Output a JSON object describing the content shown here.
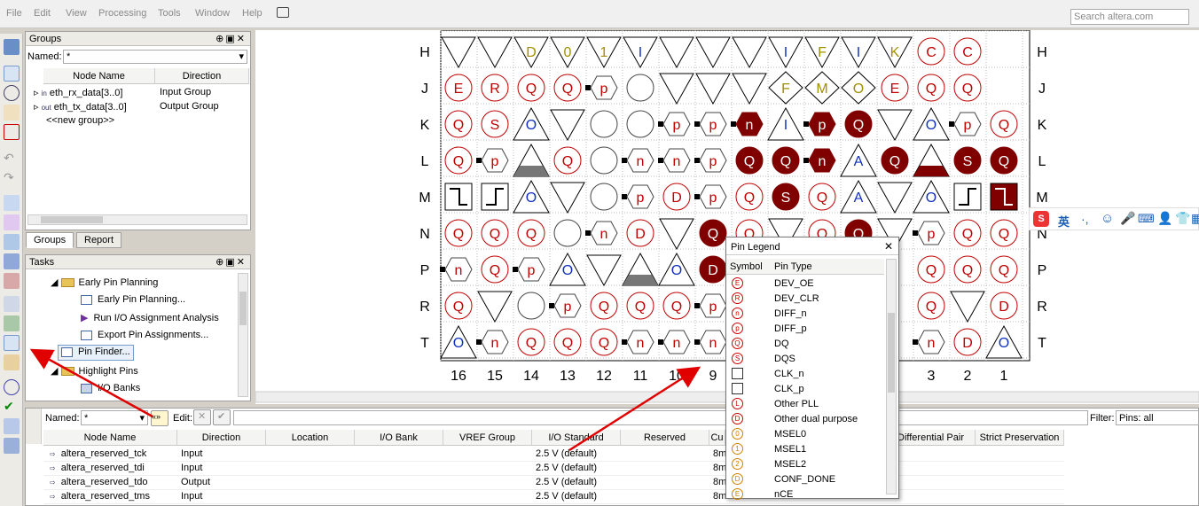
{
  "menu": [
    "File",
    "Edit",
    "View",
    "Processing",
    "Tools",
    "Window",
    "Help"
  ],
  "search_placeholder": "Search altera.com",
  "groups_panel": {
    "title": "Groups",
    "named_label": "Named:",
    "named_value": "*",
    "col_node": "Node Name",
    "col_direction": "Direction",
    "rows": [
      {
        "name": "eth_rx_data[3..0]",
        "direction": "Input Group"
      },
      {
        "name": "eth_tx_data[3..0]",
        "direction": "Output Group"
      },
      {
        "name": "<<new group>>",
        "direction": ""
      }
    ],
    "tab_groups": "Groups",
    "tab_report": "Report"
  },
  "tasks_panel": {
    "title": "Tasks",
    "items": [
      {
        "label": "Early Pin Planning",
        "kind": "folder",
        "indent": 0
      },
      {
        "label": "Early Pin Planning...",
        "kind": "doc",
        "indent": 1
      },
      {
        "label": "Run I/O Assignment Analysis",
        "kind": "run",
        "indent": 1
      },
      {
        "label": "Export Pin Assignments...",
        "kind": "doc",
        "indent": 1
      },
      {
        "label": "Pin Finder...",
        "kind": "doc",
        "indent": 0,
        "selected": true
      },
      {
        "label": "Highlight Pins",
        "kind": "folder",
        "indent": 0
      },
      {
        "label": "I/O Banks",
        "kind": "grid",
        "indent": 1
      }
    ]
  },
  "pin_grid": {
    "rows": [
      "H",
      "J",
      "K",
      "L",
      "M",
      "N",
      "P",
      "R",
      "T"
    ],
    "cols": [
      "16",
      "15",
      "14",
      "13",
      "12",
      "11",
      "10",
      "9",
      "",
      "",
      "",
      "",
      "",
      "3",
      "2",
      "1"
    ],
    "cells": [
      [
        "tv",
        "tv",
        "D",
        "0",
        "1",
        "I",
        "tv",
        "tv",
        "tv",
        "I",
        "F",
        "I",
        "K",
        "C",
        "C"
      ],
      [
        "E",
        "R",
        "Q",
        "Q",
        "p",
        "o",
        "tv",
        "tv",
        "tv",
        "F",
        "M",
        "O",
        "E",
        "Q",
        "Q"
      ],
      [
        "Q",
        "S",
        "Ot",
        "tv",
        "o",
        "o",
        "p",
        "p",
        "nF",
        "It",
        "pF",
        "QF",
        "tv",
        "Ot",
        "p",
        "Q"
      ],
      [
        "Q",
        "p",
        "tF",
        "Q",
        "o",
        "n",
        "n",
        "p",
        "QF",
        "QF",
        "nF",
        "At",
        "QF",
        "tF",
        "SF",
        "QF"
      ],
      [
        "Ck",
        "Cp",
        "Ot",
        "tv",
        "o",
        "p",
        "D",
        "p",
        "Q",
        "SF",
        "Q",
        "At",
        "tv",
        "Ot",
        "Cp",
        "CkF"
      ],
      [
        "Q",
        "Q",
        "Q",
        "o",
        "n",
        "D",
        "tv",
        "QF",
        "Q",
        "tv",
        "Q",
        "QF",
        "tv",
        "p",
        "Q",
        "Q"
      ],
      [
        "n",
        "Q",
        "p",
        "Ot",
        "tv",
        "tF",
        "Ot",
        "DF",
        "",
        "",
        "",
        "",
        "",
        "Q",
        "Q",
        "Q"
      ],
      [
        "Q",
        "tv",
        "o",
        "p",
        "Q",
        "Q",
        "Q",
        "p",
        "",
        "",
        "",
        "",
        "",
        "Q",
        "tv",
        "D"
      ],
      [
        "Ot",
        "n",
        "Q",
        "Q",
        "Q",
        "n",
        "n",
        "n",
        "",
        "",
        "",
        "",
        "",
        "n",
        "D",
        "Ot"
      ]
    ]
  },
  "legend": {
    "title": "Pin Legend",
    "col_symbol": "Symbol",
    "col_type": "Pin Type",
    "rows": [
      {
        "sym": "E",
        "type": "DEV_OE"
      },
      {
        "sym": "R",
        "type": "DEV_CLR"
      },
      {
        "sym": "n",
        "type": "DIFF_n"
      },
      {
        "sym": "p",
        "type": "DIFF_p"
      },
      {
        "sym": "Q",
        "type": "DQ"
      },
      {
        "sym": "S",
        "type": "DQS"
      },
      {
        "sym": "",
        "type": "CLK_n"
      },
      {
        "sym": "",
        "type": "CLK_p"
      },
      {
        "sym": "L",
        "type": "Other PLL"
      },
      {
        "sym": "D",
        "type": "Other dual purpose"
      },
      {
        "sym": "0",
        "type": "MSEL0"
      },
      {
        "sym": "1",
        "type": "MSEL1"
      },
      {
        "sym": "2",
        "type": "MSEL2"
      },
      {
        "sym": "D",
        "type": "CONF_DONE"
      },
      {
        "sym": "E",
        "type": "nCE"
      }
    ]
  },
  "bottom": {
    "named_label": "Named:",
    "named_value": "*",
    "edit_label": "Edit:",
    "filter_label": "Filter:",
    "filter_value": "Pins: all",
    "columns": [
      "Node Name",
      "Direction",
      "Location",
      "I/O Bank",
      "VREF Group",
      "I/O Standard",
      "Reserved",
      "Cu",
      "Differential Pair",
      "Strict Preservation"
    ],
    "rows": [
      {
        "name": "altera_reserved_tck",
        "direction": "Input",
        "std": "2.5 V (default)",
        "cu": "8m"
      },
      {
        "name": "altera_reserved_tdi",
        "direction": "Input",
        "std": "2.5 V (default)",
        "cu": "8m"
      },
      {
        "name": "altera_reserved_tdo",
        "direction": "Output",
        "std": "2.5 V (default)",
        "cu": "8m"
      },
      {
        "name": "altera_reserved_tms",
        "direction": "Input",
        "std": "2.5 V (default)",
        "cu": "8m"
      }
    ]
  },
  "sogou": {
    "label": "英"
  },
  "colors": {
    "pin_fill": "#800000",
    "pin_stroke": "#c00000",
    "arrow": "#e00000"
  }
}
